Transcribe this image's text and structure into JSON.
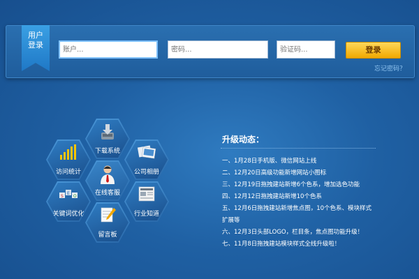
{
  "login": {
    "ribbon_line1": "用户",
    "ribbon_line2": "登录",
    "account_placeholder": "账户...",
    "password_placeholder": "密码...",
    "captcha_placeholder": "验证码...",
    "submit_label": "登录",
    "forgot_label": "忘记密码？"
  },
  "hexmenu": {
    "download": "下载系统",
    "stats": "访问统计",
    "album": "公司相册",
    "service": "在线客服",
    "keywords": "关键词优化",
    "news": "行业知道",
    "guestbook": "留言板"
  },
  "news": {
    "title": "升级动态：",
    "items": [
      "一、1月28日手机版、微信网站上线",
      "二、12月20日高级功能新增网站小图标",
      "三、12月19日拖拽建站新增6个色系，增加选色功能",
      "四、12月12日拖拽建站新增10个色系",
      "五、12月6日拖拽建站新增焦点图，10个色系、模块样式",
      "扩展等",
      "六、12月3日头部LOGO，栏目条，焦点图功能升级！",
      "七、11月8日拖拽建站模块样式全线升级啦！"
    ]
  },
  "colors": {
    "accent": "#f0a800",
    "background": "#1f60a3",
    "link": "#8fc3ef"
  }
}
